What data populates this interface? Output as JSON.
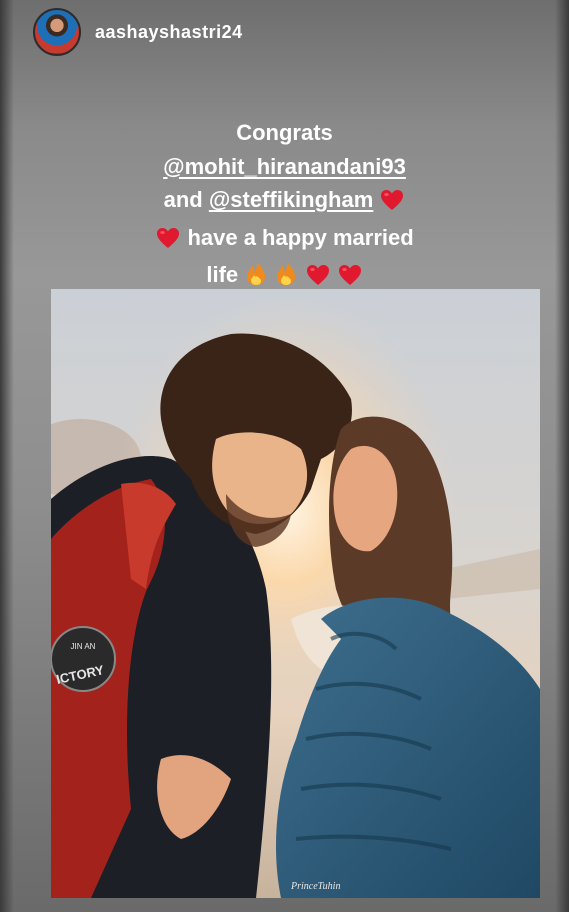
{
  "story": {
    "user": {
      "username": "aashayshastri24",
      "avatar_icon": "avatar-photo"
    },
    "caption": {
      "line1": "Congrats",
      "mention1": "@mohit_hiranandani93",
      "line3_prefix": "and ",
      "mention2": "@steffikingham",
      "line4_text": "have a happy married",
      "line5_text": "life"
    },
    "emojis": [
      "heart",
      "fire"
    ],
    "photo": {
      "description_icon": "couple-photo",
      "jacket_patch_top": "JIN AN",
      "jacket_patch_bottom": "ICTORY",
      "watermark": "PrinceTuhin"
    }
  },
  "colors": {
    "text": "#ffffff",
    "heart": "#e0192e",
    "fire": "#f5a623"
  }
}
